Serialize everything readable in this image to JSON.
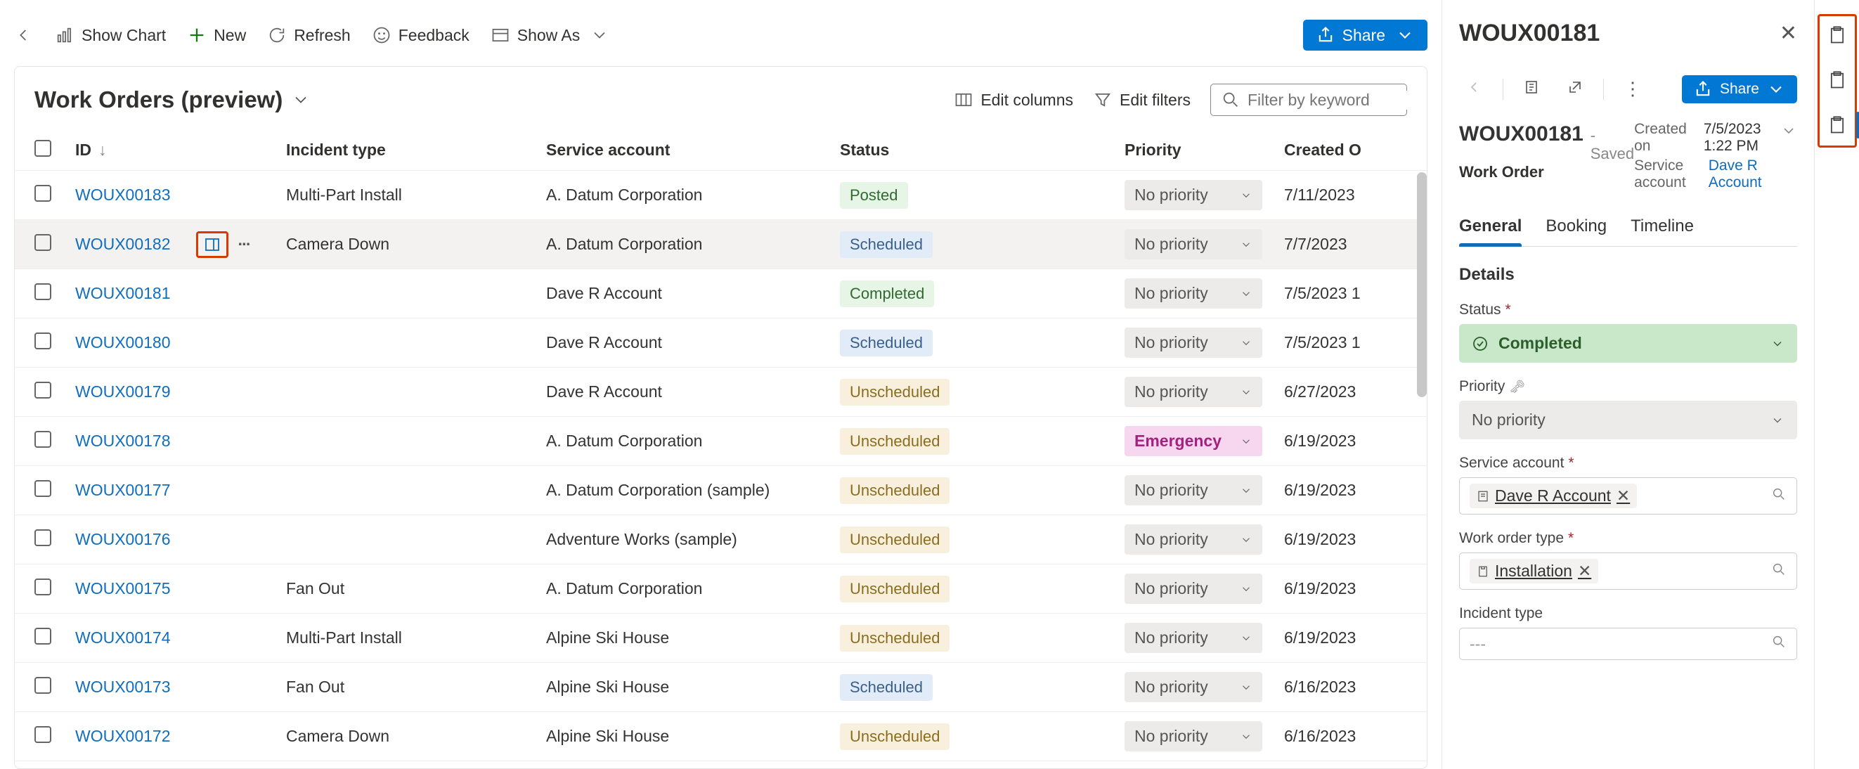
{
  "commands": {
    "show_chart": "Show Chart",
    "new": "New",
    "refresh": "Refresh",
    "feedback": "Feedback",
    "show_as": "Show As",
    "share": "Share"
  },
  "view": {
    "title": "Work Orders (preview)",
    "edit_columns": "Edit columns",
    "edit_filters": "Edit filters",
    "filter_placeholder": "Filter by keyword"
  },
  "columns": {
    "id": "ID",
    "incident": "Incident type",
    "service": "Service account",
    "status": "Status",
    "priority": "Priority",
    "created": "Created O"
  },
  "rows": [
    {
      "id": "WOUX00183",
      "incident": "Multi-Part Install",
      "service": "A. Datum Corporation",
      "status": "Posted",
      "priority": "No priority",
      "created": "7/11/2023"
    },
    {
      "id": "WOUX00182",
      "incident": "Camera Down",
      "service": "A. Datum Corporation",
      "status": "Scheduled",
      "priority": "No priority",
      "created": "7/7/2023",
      "hovered": true,
      "row_actions": true
    },
    {
      "id": "WOUX00181",
      "incident": "",
      "service": "Dave R Account",
      "status": "Completed",
      "priority": "No priority",
      "created": "7/5/2023 1"
    },
    {
      "id": "WOUX00180",
      "incident": "",
      "service": "Dave R Account",
      "status": "Scheduled",
      "priority": "No priority",
      "created": "7/5/2023 1"
    },
    {
      "id": "WOUX00179",
      "incident": "",
      "service": "Dave R Account",
      "status": "Unscheduled",
      "priority": "No priority",
      "created": "6/27/2023"
    },
    {
      "id": "WOUX00178",
      "incident": "",
      "service": "A. Datum Corporation",
      "status": "Unscheduled",
      "priority": "Emergency",
      "created": "6/19/2023"
    },
    {
      "id": "WOUX00177",
      "incident": "",
      "service": "A. Datum Corporation (sample)",
      "status": "Unscheduled",
      "priority": "No priority",
      "created": "6/19/2023"
    },
    {
      "id": "WOUX00176",
      "incident": "",
      "service": "Adventure Works (sample)",
      "status": "Unscheduled",
      "priority": "No priority",
      "created": "6/19/2023"
    },
    {
      "id": "WOUX00175",
      "incident": "Fan Out",
      "service": "A. Datum Corporation",
      "status": "Unscheduled",
      "priority": "No priority",
      "created": "6/19/2023"
    },
    {
      "id": "WOUX00174",
      "incident": "Multi-Part Install",
      "service": "Alpine Ski House",
      "status": "Unscheduled",
      "priority": "No priority",
      "created": "6/19/2023"
    },
    {
      "id": "WOUX00173",
      "incident": "Fan Out",
      "service": "Alpine Ski House",
      "status": "Scheduled",
      "priority": "No priority",
      "created": "6/16/2023"
    },
    {
      "id": "WOUX00172",
      "incident": "Camera Down",
      "service": "Alpine Ski House",
      "status": "Unscheduled",
      "priority": "No priority",
      "created": "6/16/2023"
    }
  ],
  "panel": {
    "title": "WOUX00181",
    "share": "Share",
    "record_id": "WOUX00181",
    "saved": "- Saved",
    "entity": "Work Order",
    "created_on_label": "Created on",
    "created_on_value": "7/5/2023 1:22 PM",
    "service_account_label": "Service account",
    "service_account_value": "Dave R Account",
    "tabs": [
      "General",
      "Booking",
      "Timeline"
    ],
    "details_heading": "Details",
    "fields": {
      "status_label": "Status",
      "status_value": "Completed",
      "priority_label": "Priority",
      "priority_value": "No priority",
      "service_label": "Service account",
      "service_value": "Dave R Account",
      "wotype_label": "Work order type",
      "wotype_value": "Installation",
      "incident_label": "Incident type",
      "incident_placeholder": "---"
    }
  }
}
